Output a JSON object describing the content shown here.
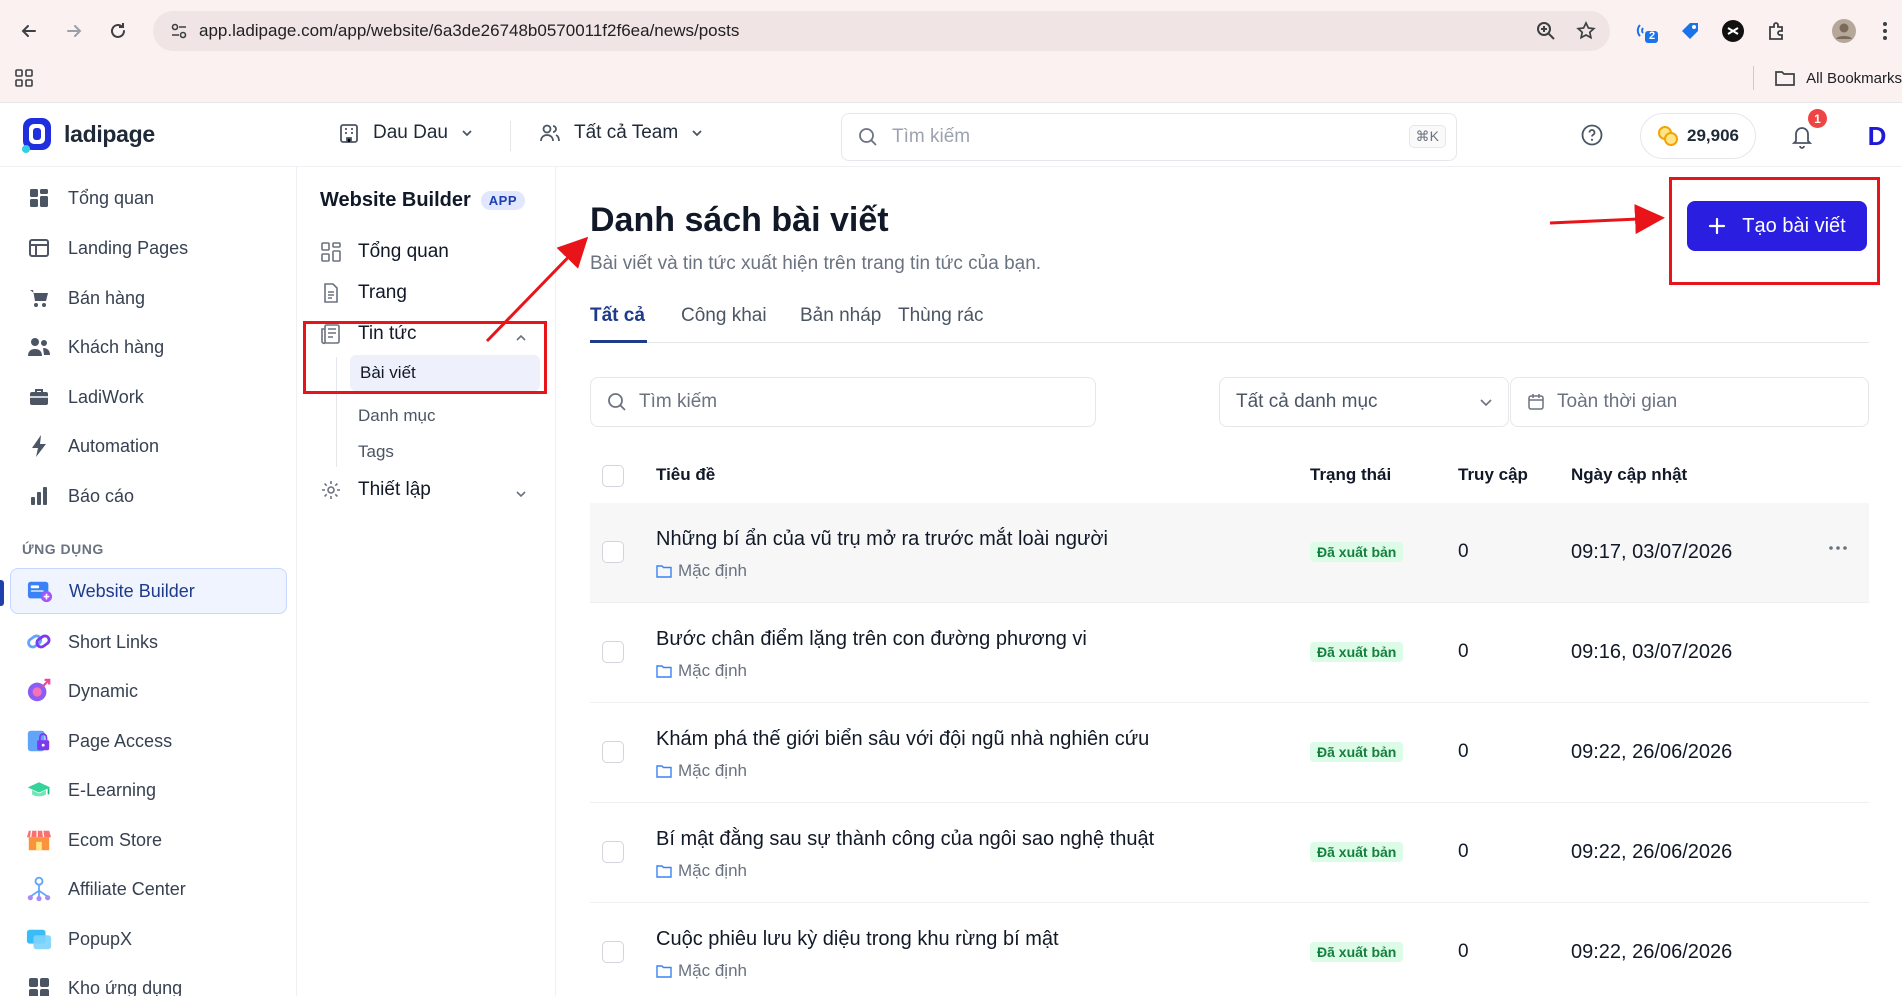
{
  "browser": {
    "url": "app.ladipage.com/app/website/6a3de26748b0570011f2f6ea/news/posts",
    "extension_badge": "2",
    "bookmarks_label": "All Bookmarks"
  },
  "header": {
    "logo_text": "ladipage",
    "workspace": "Dau Dau",
    "team": "Tất cả Team",
    "search_placeholder": "Tìm kiếm",
    "search_shortcut": "⌘K",
    "credits": "29,906",
    "notification_count": "1",
    "avatar_initial": "D"
  },
  "sidebar": {
    "items": [
      {
        "label": "Tổng quan",
        "icon": "dashboard-icon"
      },
      {
        "label": "Landing Pages",
        "icon": "layout-icon"
      },
      {
        "label": "Bán hàng",
        "icon": "cart-icon"
      },
      {
        "label": "Khách hàng",
        "icon": "users-icon"
      },
      {
        "label": "LadiWork",
        "icon": "briefcase-icon"
      },
      {
        "label": "Automation",
        "icon": "bolt-icon"
      },
      {
        "label": "Báo cáo",
        "icon": "bar-chart-icon"
      }
    ],
    "section_label": "ỨNG DỤNG",
    "apps": [
      {
        "label": "Website Builder",
        "icon": "website-builder-icon"
      },
      {
        "label": "Short Links",
        "icon": "link-icon"
      },
      {
        "label": "Dynamic",
        "icon": "dynamic-icon"
      },
      {
        "label": "Page Access",
        "icon": "lock-icon"
      },
      {
        "label": "E-Learning",
        "icon": "graduation-cap-icon"
      },
      {
        "label": "Ecom Store",
        "icon": "store-icon"
      },
      {
        "label": "Affiliate Center",
        "icon": "affiliate-icon"
      },
      {
        "label": "PopupX",
        "icon": "popup-icon"
      },
      {
        "label": "Kho ứng dụng",
        "icon": "app-store-icon"
      }
    ]
  },
  "subnav": {
    "title": "Website Builder",
    "badge": "APP",
    "items": {
      "overview": "Tổng quan",
      "pages": "Trang",
      "news": "Tin tức",
      "posts": "Bài viết",
      "categories": "Danh mục",
      "tags": "Tags",
      "settings": "Thiết lập"
    }
  },
  "main": {
    "title": "Danh sách bài viết",
    "subtitle": "Bài viết và tin tức xuất hiện trên trang tin tức của bạn.",
    "create_button": "Tạo bài viết",
    "tabs": [
      "Tất cả",
      "Công khai",
      "Bản nháp",
      "Thùng rác"
    ],
    "filters": {
      "search_placeholder": "Tìm kiếm",
      "category": "Tất cả danh mục",
      "date": "Toàn thời gian"
    },
    "columns": [
      "Tiêu đề",
      "Trạng thái",
      "Truy cập",
      "Ngày cập nhật"
    ],
    "rows": [
      {
        "title": "Những bí ẩn của vũ trụ mở ra trước mắt loài người",
        "category": "Mặc định",
        "status": "Đã xuất bản",
        "visits": "0",
        "updated": "09:17, 03/07/2026"
      },
      {
        "title": "Bước chân điểm lặng trên con đường phương vi",
        "category": "Mặc định",
        "status": "Đã xuất bản",
        "visits": "0",
        "updated": "09:16, 03/07/2026"
      },
      {
        "title": "Khám phá thế giới biển sâu với đội ngũ nhà nghiên cứu",
        "category": "Mặc định",
        "status": "Đã xuất bản",
        "visits": "0",
        "updated": "09:22, 26/06/2026"
      },
      {
        "title": "Bí mật đằng sau sự thành công của ngôi sao nghệ thuật",
        "category": "Mặc định",
        "status": "Đã xuất bản",
        "visits": "0",
        "updated": "09:22, 26/06/2026"
      },
      {
        "title": "Cuộc phiêu lưu kỳ diệu trong khu rừng bí mật",
        "category": "Mặc định",
        "status": "Đã xuất bản",
        "visits": "0",
        "updated": "09:22, 26/06/2026"
      }
    ]
  },
  "colors": {
    "primary": "#2a1fe0",
    "active_nav": "#1e3a8a",
    "annotation": "#e8141a",
    "status_bg": "#dcfce7",
    "status_text": "#15803d"
  }
}
